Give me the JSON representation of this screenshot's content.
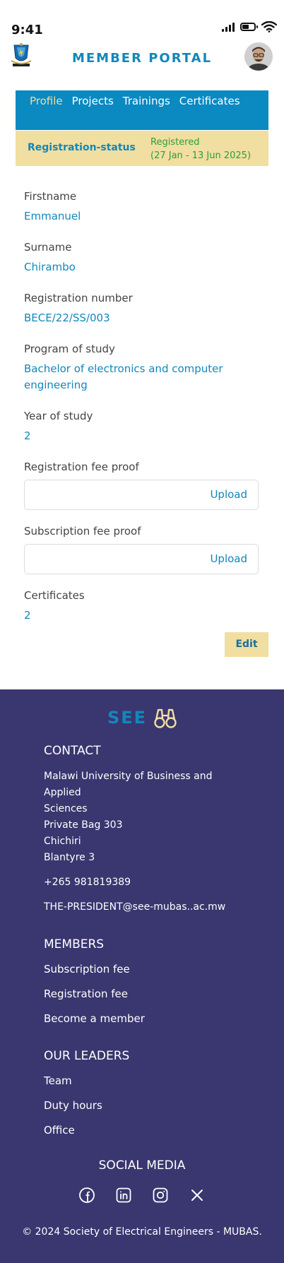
{
  "status_bar": {
    "time": "9:41"
  },
  "header": {
    "title": "MEMBER PORTAL"
  },
  "nav": {
    "items": [
      {
        "label": "Profile",
        "active": true
      },
      {
        "label": "Projects"
      },
      {
        "label": "Trainings"
      },
      {
        "label": "Certificates"
      }
    ]
  },
  "registration": {
    "label": "Registration-status",
    "status": "Registered",
    "period": "(27 Jan - 13 Jun 2025)"
  },
  "profile": {
    "firstname_label": "Firstname",
    "firstname": "Emmanuel",
    "surname_label": "Surname",
    "surname": "Chirambo",
    "regno_label": "Registration number",
    "regno": "BECE/22/SS/003",
    "program_label": "Program of study",
    "program": "Bachelor of electronics and computer engineering",
    "year_label": "Year of study",
    "year": "2",
    "regfee_label": "Registration fee proof",
    "subfee_label": "Subscription fee proof",
    "upload_label": "Upload",
    "certificates_label": "Certificates",
    "certificates": "2",
    "edit_label": "Edit"
  },
  "footer": {
    "logo_text": "SEE",
    "contact_heading": "CONTACT",
    "address_lines": [
      "Malawi University of Business and",
      "Applied",
      "Sciences",
      "Private Bag 303",
      "Chichiri",
      "Blantyre 3"
    ],
    "phone": "+265 981819389",
    "email": "THE-PRESIDENT@see-mubas..ac.mw",
    "members_heading": "MEMBERS",
    "members_links": [
      "Subscription fee",
      "Registration fee",
      "Become a member"
    ],
    "leaders_heading": "OUR LEADERS",
    "leaders_links": [
      "Team",
      "Duty hours",
      "Office"
    ],
    "social_heading": "SOCIAL MEDIA",
    "social_icons": [
      "facebook-icon",
      "linkedin-icon",
      "instagram-icon",
      "x-icon"
    ],
    "copyright": "© 2024 Society of Electrical Engineers - MUBAS."
  },
  "colors": {
    "brand_blue": "#1188bb",
    "nav_blue": "#0b89c1",
    "accent_sand": "#f1dea1",
    "status_green": "#2aa03a",
    "footer_bg": "#3a366f"
  }
}
